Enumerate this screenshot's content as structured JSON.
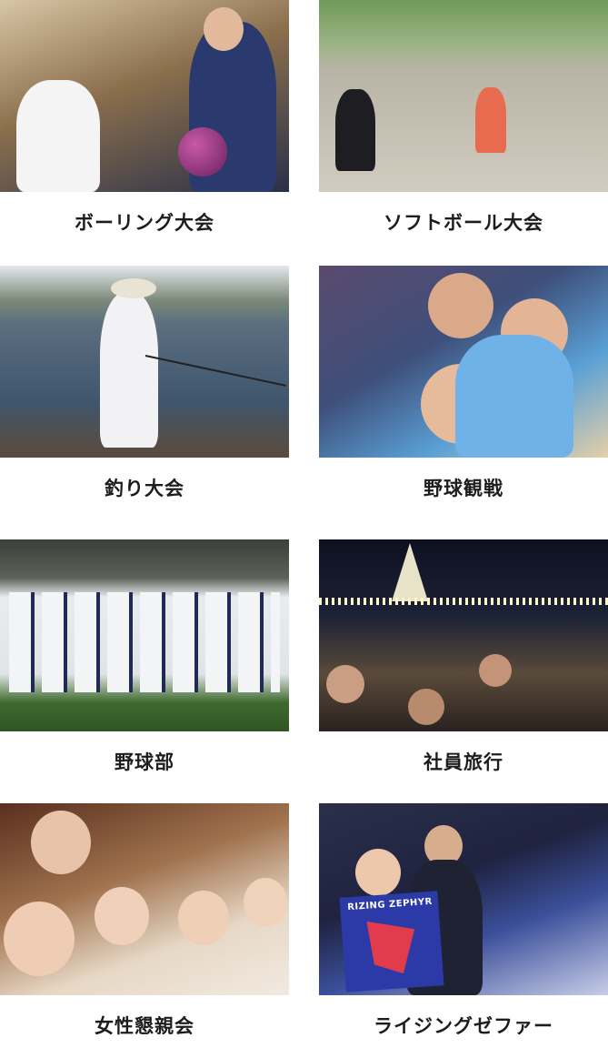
{
  "activities": [
    {
      "id": "bowling",
      "label": "ボーリング大会",
      "photo": "bowling-photo"
    },
    {
      "id": "softball",
      "label": "ソフトボール大会",
      "photo": "softball-photo"
    },
    {
      "id": "fishing",
      "label": "釣り大会",
      "photo": "fishing-photo"
    },
    {
      "id": "baseball-watching",
      "label": "野球観戦",
      "photo": "baseball-watching-photo"
    },
    {
      "id": "baseball-club",
      "label": "野球部",
      "photo": "baseball-team-photo"
    },
    {
      "id": "company-trip",
      "label": "社員旅行",
      "photo": "company-trip-photo"
    },
    {
      "id": "womens-social",
      "label": "女性懇親会",
      "photo": "womens-social-photo"
    },
    {
      "id": "rising-zephyr",
      "label": "ライジングゼファー",
      "photo": "rising-zephyr-photo"
    }
  ],
  "sign_text": "RIZING ZEPHYR",
  "colors": {
    "caption_text": "#1d1d1d",
    "background": "#ffffff"
  }
}
